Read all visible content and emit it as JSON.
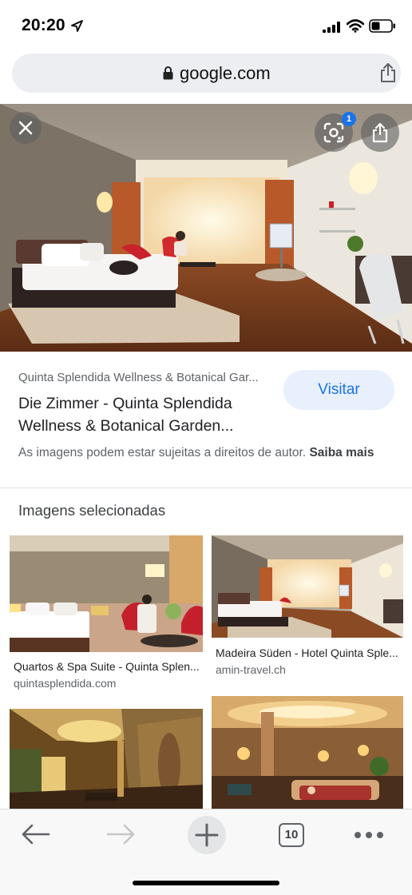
{
  "status_bar": {
    "time": "20:20",
    "icons": [
      "location-arrow-icon",
      "signal-icon",
      "wifi-icon",
      "battery-icon"
    ]
  },
  "url_bar": {
    "domain": "google.com",
    "icons": [
      "lock-icon",
      "share-icon"
    ]
  },
  "hero": {
    "image": "hotel-room-photo",
    "lens_badge_count": "1",
    "icons": [
      "close-icon",
      "google-lens-icon",
      "share-icon"
    ]
  },
  "result": {
    "source": "Quinta Splendida Wellness & Botanical Gar...",
    "title": "Die Zimmer - Quinta Splendida Wellness & Botanical Garden...",
    "visit_label": "Visitar",
    "copyright_text": "As imagens podem estar sujeitas a direitos de autor.",
    "learn_more": "Saiba mais"
  },
  "related": {
    "heading": "Imagens selecionadas",
    "items": [
      {
        "caption": "Quartos & Spa Suite - Quinta Splen...",
        "domain": "quintasplendida.com"
      },
      {
        "caption": "Madeira Süden - Hotel Quinta Sple...",
        "domain": "amin-travel.ch"
      },
      {
        "caption": "",
        "domain": ""
      },
      {
        "caption": "",
        "domain": ""
      }
    ]
  },
  "toolbar": {
    "tab_count": "10",
    "icons": [
      "back-arrow-icon",
      "forward-arrow-icon",
      "new-tab-plus-icon",
      "tabs-icon",
      "more-dots-icon"
    ]
  },
  "colors": {
    "accent": "#1a73e8",
    "visit_button_bg": "#e8f0fe",
    "url_bar_bg": "#eceef1"
  }
}
